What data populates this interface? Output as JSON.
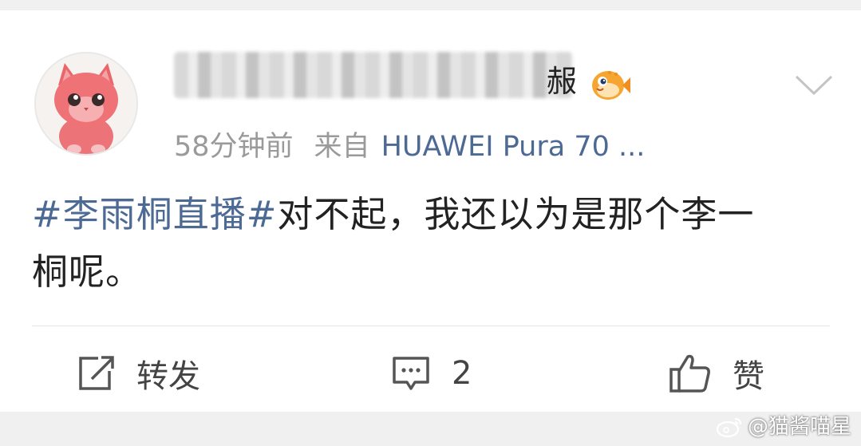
{
  "post": {
    "author": {
      "name_visible_suffix": "赧",
      "avatar": "pink-cat-avatar",
      "badge_icon": "pufferfish-badge-icon"
    },
    "meta": {
      "time": "58分钟前",
      "source_label": "来自",
      "device": "HUAWEI Pura 70 ..."
    },
    "content": {
      "hashtag": "#李雨桐直播#",
      "text_line1": "对不起，我还以为是那个李一",
      "text_line2": "桐呢。"
    }
  },
  "actions": {
    "repost_label": "转发",
    "comment_count": "2",
    "like_label": "赞"
  },
  "watermark": {
    "text": "@猫酱喵星",
    "icon": "weibo-icon"
  },
  "colors": {
    "link": "#4d6a94",
    "meta": "#9a9a9a",
    "text": "#222222"
  }
}
